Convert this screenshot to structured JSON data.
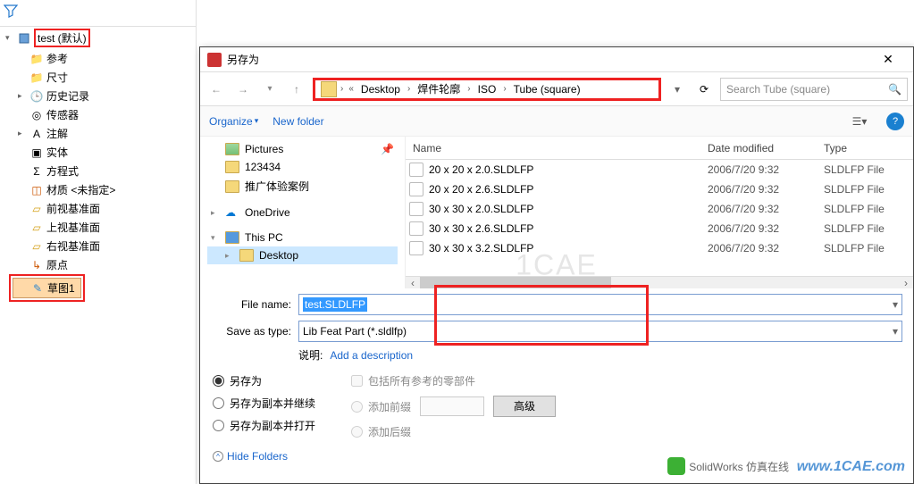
{
  "tree": {
    "root": "test (默认)",
    "items": [
      {
        "label": "参考",
        "icon": "folder"
      },
      {
        "label": "尺寸",
        "icon": "folder"
      },
      {
        "label": "历史记录",
        "icon": "history",
        "expandable": true
      },
      {
        "label": "传感器",
        "icon": "sensor"
      },
      {
        "label": "注解",
        "icon": "annotation",
        "expandable": true
      },
      {
        "label": "实体",
        "icon": "solid"
      },
      {
        "label": "方程式",
        "icon": "equation"
      },
      {
        "label": "材质 <未指定>",
        "icon": "material"
      },
      {
        "label": "前视基准面",
        "icon": "plane"
      },
      {
        "label": "上视基准面",
        "icon": "plane"
      },
      {
        "label": "右视基准面",
        "icon": "plane"
      },
      {
        "label": "原点",
        "icon": "origin"
      },
      {
        "label": "草图1",
        "icon": "sketch",
        "selected": true
      }
    ]
  },
  "dialog": {
    "title": "另存为",
    "breadcrumb": [
      "Desktop",
      "焊件轮廓",
      "ISO",
      "Tube (square)"
    ],
    "search_placeholder": "Search Tube (square)",
    "toolbar": {
      "organize": "Organize",
      "new_folder": "New folder"
    },
    "nav_items": [
      {
        "label": "Pictures",
        "type": "pics",
        "pinned": true
      },
      {
        "label": "123434",
        "type": "folder"
      },
      {
        "label": "推广体验案例",
        "type": "folder"
      },
      {
        "label": "OneDrive",
        "type": "onedrive",
        "expandable": true
      },
      {
        "label": "This PC",
        "type": "pc",
        "expandable": true
      },
      {
        "label": "Desktop",
        "type": "folder",
        "selected": true,
        "indent": true
      }
    ],
    "columns": {
      "name": "Name",
      "date": "Date modified",
      "type": "Type"
    },
    "files": [
      {
        "name": "20 x 20 x 2.0.SLDLFP",
        "date": "2006/7/20 9:32",
        "type": "SLDLFP File"
      },
      {
        "name": "20 x 20 x 2.6.SLDLFP",
        "date": "2006/7/20 9:32",
        "type": "SLDLFP File"
      },
      {
        "name": "30 x 30 x 2.0.SLDLFP",
        "date": "2006/7/20 9:32",
        "type": "SLDLFP File"
      },
      {
        "name": "30 x 30 x 2.6.SLDLFP",
        "date": "2006/7/20 9:32",
        "type": "SLDLFP File"
      },
      {
        "name": "30 x 30 x 3.2.SLDLFP",
        "date": "2006/7/20 9:32",
        "type": "SLDLFP File"
      }
    ],
    "file_name_label": "File name:",
    "file_name_value": "test.SLDLFP",
    "save_type_label": "Save as type:",
    "save_type_value": "Lib Feat Part (*.sldlfp)",
    "desc_label": "说明:",
    "desc_link": "Add a description",
    "options": {
      "r1": "另存为",
      "r2": "另存为副本并继续",
      "r3": "另存为副本并打开",
      "chk1": "包括所有参考的零部件",
      "chk2": "添加前缀",
      "chk3": "添加后缀",
      "advanced": "高级"
    },
    "hide_folders": "Hide Folders",
    "close": "✕"
  },
  "watermark": "1CAE",
  "page_watermark": "www.1CAE.com",
  "page_watermark2": "SolidWorks 仿真在线"
}
